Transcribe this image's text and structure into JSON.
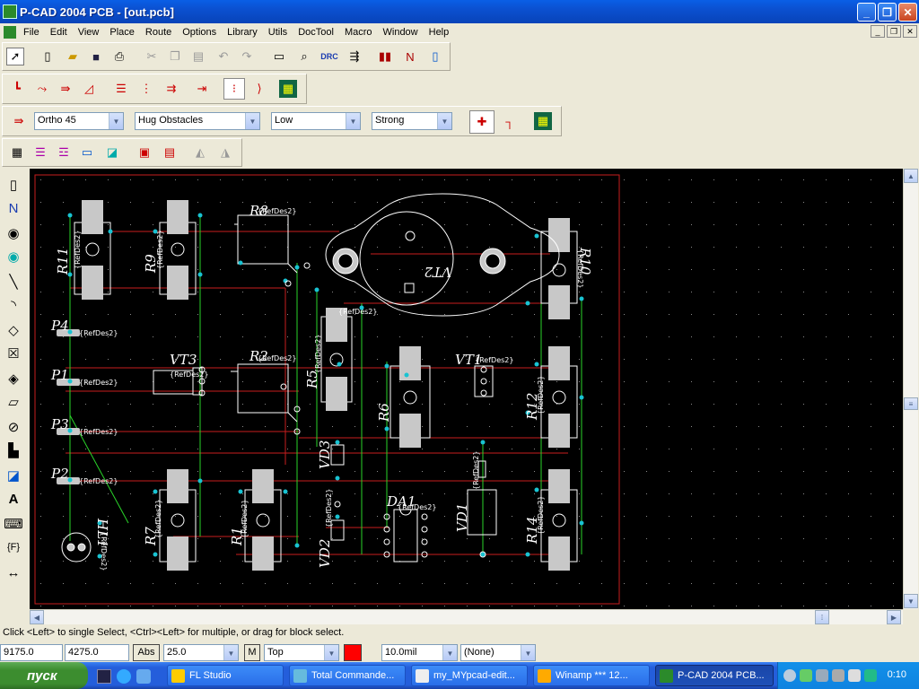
{
  "window": {
    "title": "P-CAD 2004 PCB - [out.pcb]"
  },
  "menu": [
    "File",
    "Edit",
    "View",
    "Place",
    "Route",
    "Options",
    "Library",
    "Utils",
    "DocTool",
    "Macro",
    "Window",
    "Help"
  ],
  "route_toolbar": {
    "mode": "Ortho 45",
    "obstacles": "Hug Obstacles",
    "effort": "Low",
    "strength": "Strong"
  },
  "board": {
    "labels": {
      "R11": "R11",
      "R9": "R9",
      "R8": "R8",
      "VT2": "VT2",
      "R10": "R10",
      "P4": "P4",
      "P1": "P1",
      "P3": "P3",
      "P2": "P2",
      "VT3": "VT3",
      "R2": "R2",
      "R5": "R5",
      "R6": "R6",
      "VT1": "VT1",
      "R12": "R12",
      "VD3": "VD3",
      "VD1": "VD1",
      "R7": "R7",
      "R1": "R1",
      "DA1": "DA1",
      "VD2": "VD2",
      "R14": "R14",
      "HL1": "HL1",
      "refdes": "{RefDes2}"
    }
  },
  "status": {
    "message": "Click <Left> to single Select, <Ctrl><Left> for multiple, or drag for block select.",
    "x": "9175.0",
    "y": "4275.0",
    "abs": "Abs",
    "grid": "25.0",
    "m": "M",
    "layer": "Top",
    "width": "10.0mil",
    "net": "(None)"
  },
  "taskbar": {
    "start": "пуск",
    "items": [
      "FL Studio",
      "Total Commande...",
      "my_MYpcad-edit...",
      "Winamp *** 12...",
      "P-CAD 2004 PCB..."
    ],
    "clock": "0:10"
  },
  "colors": {
    "accent": "#0a5fe6",
    "board_outline": "#c81e1e",
    "copper": "#c81e1e",
    "pad": "#c8c8c8",
    "silk": "#ffffff",
    "via": "#19c3d2"
  }
}
